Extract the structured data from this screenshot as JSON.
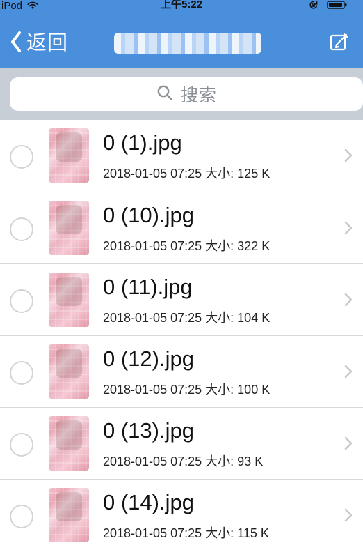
{
  "status_bar": {
    "carrier": "iPod",
    "time": "上午5:22"
  },
  "nav": {
    "back_label": "返回",
    "title_obscured": true
  },
  "search": {
    "placeholder": "搜索"
  },
  "files": [
    {
      "name": "0 (1).jpg",
      "datetime": "2018-01-05 07:25",
      "size_label": "大小:",
      "size_value": "125 K"
    },
    {
      "name": "0 (10).jpg",
      "datetime": "2018-01-05 07:25",
      "size_label": "大小:",
      "size_value": "322 K"
    },
    {
      "name": "0 (11).jpg",
      "datetime": "2018-01-05 07:25",
      "size_label": "大小:",
      "size_value": "104 K"
    },
    {
      "name": "0 (12).jpg",
      "datetime": "2018-01-05 07:25",
      "size_label": "大小:",
      "size_value": "100 K"
    },
    {
      "name": "0 (13).jpg",
      "datetime": "2018-01-05 07:25",
      "size_label": "大小:",
      "size_value": "93 K"
    },
    {
      "name": "0 (14).jpg",
      "datetime": "2018-01-05 07:25",
      "size_label": "大小:",
      "size_value": "115 K"
    }
  ],
  "icons": {
    "status_wifi": "wifi-icon",
    "status_rotation_lock": "rotation-lock-icon",
    "status_battery": "battery-icon",
    "nav_back": "chevron-left-icon",
    "nav_edit": "edit-icon",
    "search": "search-icon",
    "row_radio": "radio-icon",
    "row_chevron": "chevron-right-icon"
  },
  "colors": {
    "nav_blue": "#4a8fdc",
    "search_bar_bg": "#c8ced6",
    "divider": "#d6d8db"
  }
}
